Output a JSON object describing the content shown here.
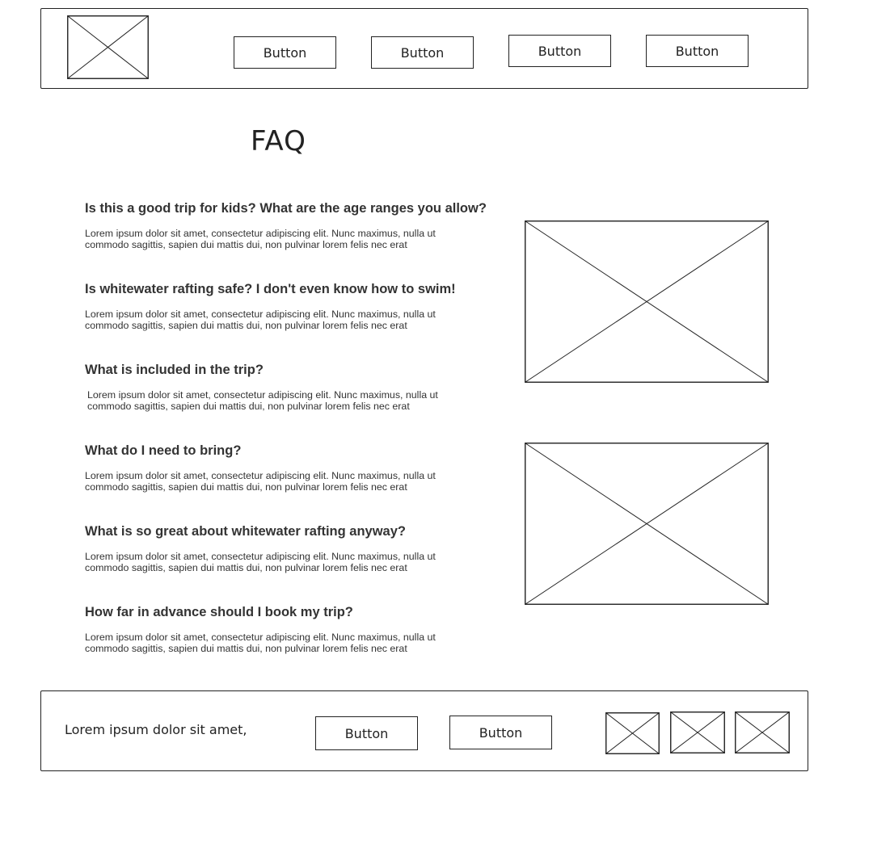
{
  "header": {
    "nav_buttons": [
      "Button",
      "Button",
      "Button",
      "Button"
    ]
  },
  "faq": {
    "title": "FAQ",
    "items": [
      {
        "question": "Is this a good trip for kids? What are the age ranges you allow?",
        "answer": "Lorem ipsum dolor sit amet, consectetur adipiscing elit. Nunc maximus, nulla ut commodo sagittis, sapien dui mattis dui, non pulvinar lorem felis nec erat"
      },
      {
        "question": "Is whitewater rafting safe? I don't even know how to swim!",
        "answer": "Lorem ipsum dolor sit amet, consectetur adipiscing elit. Nunc maximus, nulla ut commodo sagittis, sapien dui mattis dui, non pulvinar lorem felis nec erat"
      },
      {
        "question": "What is included in the trip?",
        "answer": "Lorem ipsum dolor sit amet, consectetur adipiscing elit. Nunc maximus, nulla ut commodo sagittis, sapien dui mattis dui, non pulvinar lorem felis nec erat"
      },
      {
        "question": "What do I need to bring?",
        "answer": "Lorem ipsum dolor sit amet, consectetur adipiscing elit. Nunc maximus, nulla ut commodo sagittis, sapien dui mattis dui, non pulvinar lorem felis nec erat"
      },
      {
        "question": "What is so great about whitewater rafting anyway?",
        "answer": "Lorem ipsum dolor sit amet, consectetur adipiscing elit. Nunc maximus, nulla ut commodo sagittis, sapien dui mattis dui, non pulvinar lorem felis nec erat"
      },
      {
        "question": "How far in advance should I book my trip?",
        "answer": "Lorem ipsum dolor sit amet, consectetur adipiscing elit. Nunc maximus, nulla ut commodo sagittis, sapien dui mattis dui, non pulvinar lorem felis nec erat"
      }
    ]
  },
  "footer": {
    "text": "Lorem ipsum dolor sit amet,",
    "buttons": [
      "Button",
      "Button"
    ]
  }
}
